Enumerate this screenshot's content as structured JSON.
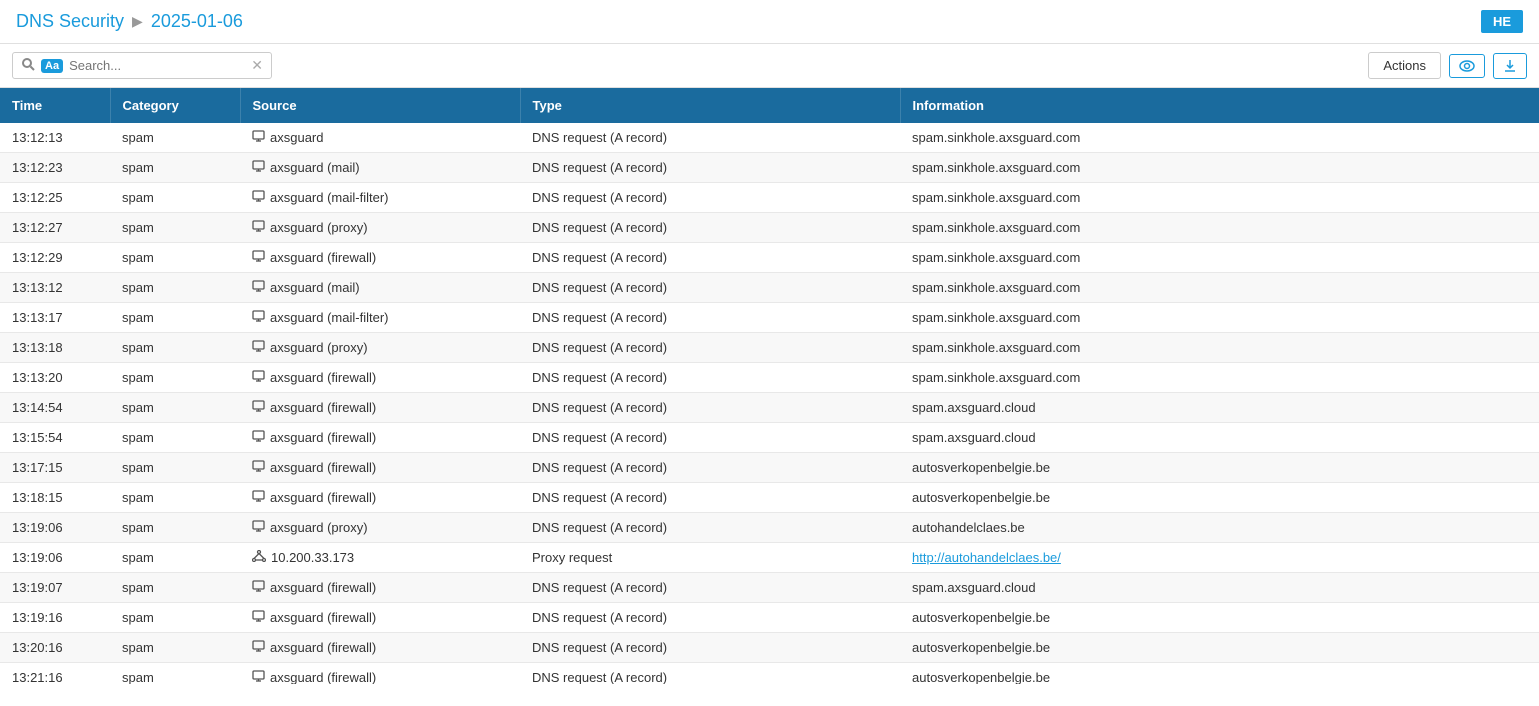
{
  "header": {
    "title": "DNS Security",
    "arrow": "▶",
    "date": "2025-01-06",
    "he_label": "HE"
  },
  "toolbar": {
    "search_placeholder": "Search...",
    "aa_badge": "Aa",
    "actions_label": "Actions",
    "view_icon": "eye",
    "download_icon": "download"
  },
  "table": {
    "columns": [
      "Time",
      "Category",
      "Source",
      "Type",
      "Information"
    ],
    "rows": [
      {
        "time": "13:12:13",
        "category": "spam",
        "source_icon": "monitor",
        "source": "axsguard",
        "type": "DNS request (A record)",
        "info": "spam.sinkhole.axsguard.com",
        "info_link": false
      },
      {
        "time": "13:12:23",
        "category": "spam",
        "source_icon": "monitor",
        "source": "axsguard (mail)",
        "type": "DNS request (A record)",
        "info": "spam.sinkhole.axsguard.com",
        "info_link": false
      },
      {
        "time": "13:12:25",
        "category": "spam",
        "source_icon": "monitor",
        "source": "axsguard (mail-filter)",
        "type": "DNS request (A record)",
        "info": "spam.sinkhole.axsguard.com",
        "info_link": false
      },
      {
        "time": "13:12:27",
        "category": "spam",
        "source_icon": "monitor",
        "source": "axsguard (proxy)",
        "type": "DNS request (A record)",
        "info": "spam.sinkhole.axsguard.com",
        "info_link": false
      },
      {
        "time": "13:12:29",
        "category": "spam",
        "source_icon": "monitor",
        "source": "axsguard (firewall)",
        "type": "DNS request (A record)",
        "info": "spam.sinkhole.axsguard.com",
        "info_link": false
      },
      {
        "time": "13:13:12",
        "category": "spam",
        "source_icon": "monitor",
        "source": "axsguard (mail)",
        "type": "DNS request (A record)",
        "info": "spam.sinkhole.axsguard.com",
        "info_link": false
      },
      {
        "time": "13:13:17",
        "category": "spam",
        "source_icon": "monitor",
        "source": "axsguard (mail-filter)",
        "type": "DNS request (A record)",
        "info": "spam.sinkhole.axsguard.com",
        "info_link": false
      },
      {
        "time": "13:13:18",
        "category": "spam",
        "source_icon": "monitor",
        "source": "axsguard (proxy)",
        "type": "DNS request (A record)",
        "info": "spam.sinkhole.axsguard.com",
        "info_link": false
      },
      {
        "time": "13:13:20",
        "category": "spam",
        "source_icon": "monitor",
        "source": "axsguard (firewall)",
        "type": "DNS request (A record)",
        "info": "spam.sinkhole.axsguard.com",
        "info_link": false
      },
      {
        "time": "13:14:54",
        "category": "spam",
        "source_icon": "monitor",
        "source": "axsguard (firewall)",
        "type": "DNS request (A record)",
        "info": "spam.axsguard.cloud",
        "info_link": false
      },
      {
        "time": "13:15:54",
        "category": "spam",
        "source_icon": "monitor",
        "source": "axsguard (firewall)",
        "type": "DNS request (A record)",
        "info": "spam.axsguard.cloud",
        "info_link": false
      },
      {
        "time": "13:17:15",
        "category": "spam",
        "source_icon": "monitor",
        "source": "axsguard (firewall)",
        "type": "DNS request (A record)",
        "info": "autosverkopenbelgie.be",
        "info_link": false
      },
      {
        "time": "13:18:15",
        "category": "spam",
        "source_icon": "monitor",
        "source": "axsguard (firewall)",
        "type": "DNS request (A record)",
        "info": "autosverkopenbelgie.be",
        "info_link": false
      },
      {
        "time": "13:19:06",
        "category": "spam",
        "source_icon": "monitor",
        "source": "axsguard (proxy)",
        "type": "DNS request (A record)",
        "info": "autohandelclaes.be",
        "info_link": false
      },
      {
        "time": "13:19:06",
        "category": "spam",
        "source_icon": "network",
        "source": "10.200.33.173",
        "type": "Proxy request",
        "info": "http://autohandelclaes.be/",
        "info_link": true
      },
      {
        "time": "13:19:07",
        "category": "spam",
        "source_icon": "monitor",
        "source": "axsguard (firewall)",
        "type": "DNS request (A record)",
        "info": "spam.axsguard.cloud",
        "info_link": false
      },
      {
        "time": "13:19:16",
        "category": "spam",
        "source_icon": "monitor",
        "source": "axsguard (firewall)",
        "type": "DNS request (A record)",
        "info": "autosverkopenbelgie.be",
        "info_link": false
      },
      {
        "time": "13:20:16",
        "category": "spam",
        "source_icon": "monitor",
        "source": "axsguard (firewall)",
        "type": "DNS request (A record)",
        "info": "autosverkopenbelgie.be",
        "info_link": false
      },
      {
        "time": "13:21:16",
        "category": "spam",
        "source_icon": "monitor",
        "source": "axsguard (firewall)",
        "type": "DNS request (A record)",
        "info": "autosverkopenbelgie.be",
        "info_link": false
      }
    ]
  }
}
